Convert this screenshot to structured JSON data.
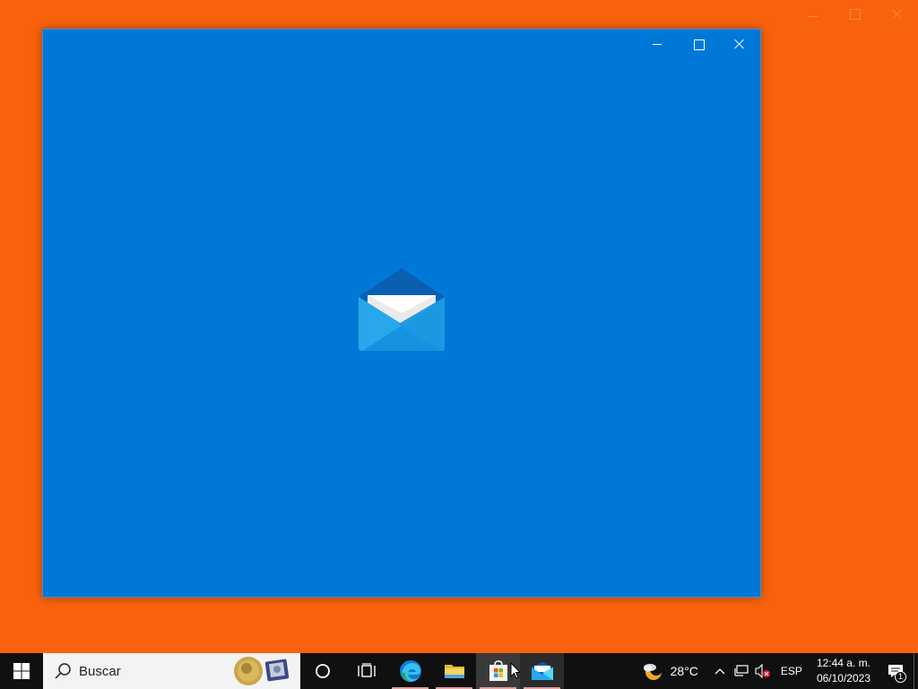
{
  "background_color": "#f8620c",
  "mail_window": {
    "background": "#0078d7",
    "controls": [
      "minimize",
      "maximize",
      "close"
    ],
    "splash_icon": "mail-envelope-icon"
  },
  "taskbar": {
    "start_icon": "windows-logo-icon",
    "search": {
      "placeholder": "Buscar",
      "icon": "search-icon",
      "highlight_icon": "nobel-medal-icon"
    },
    "pinned": [
      {
        "name": "cortana",
        "icon": "cortana-circle-icon"
      },
      {
        "name": "task-view",
        "icon": "task-view-icon"
      },
      {
        "name": "edge",
        "icon": "edge-icon",
        "running": true
      },
      {
        "name": "file-explorer",
        "icon": "folder-icon",
        "running": true
      },
      {
        "name": "microsoft-store",
        "icon": "store-icon",
        "running": true
      },
      {
        "name": "mail",
        "icon": "mail-icon",
        "running": true,
        "active": true
      }
    ],
    "tray": {
      "weather": {
        "icon": "partly-cloudy-night-icon",
        "temperature": "28°C"
      },
      "icons": [
        "chevron-up-icon",
        "network-icon",
        "volume-muted-icon"
      ],
      "language": "ESP",
      "time": "12:44 a. m.",
      "date": "06/10/2023",
      "notifications": "1"
    }
  }
}
